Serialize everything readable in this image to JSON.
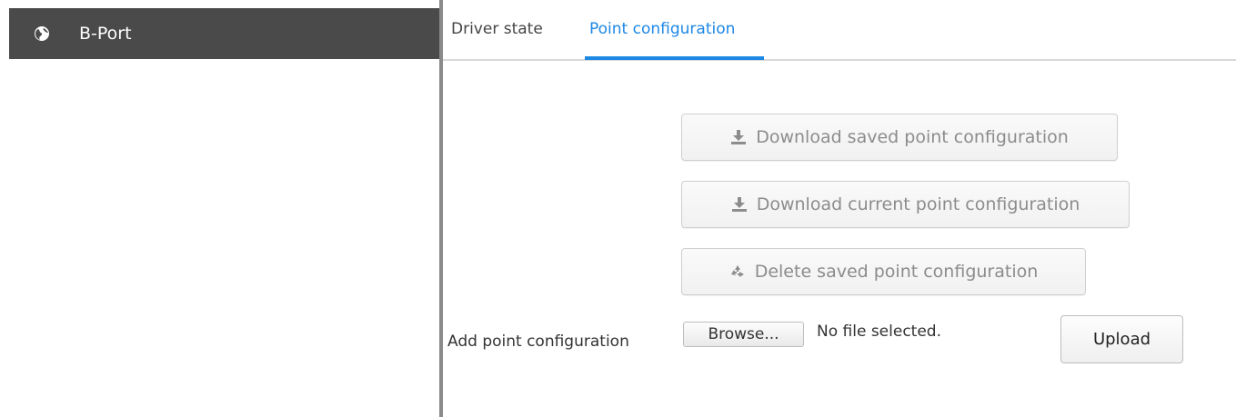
{
  "sidebar": {
    "items": [
      {
        "label": "B-Port",
        "icon": "globe-icon"
      }
    ]
  },
  "tabs": {
    "items": [
      {
        "label": "Driver state",
        "active": false
      },
      {
        "label": "Point configuration",
        "active": true
      }
    ]
  },
  "actions": {
    "download_saved": {
      "label": "Download saved point configuration",
      "icon": "download-icon"
    },
    "download_current": {
      "label": "Download current point configuration",
      "icon": "download-icon"
    },
    "delete_saved": {
      "label": "Delete saved point configuration",
      "icon": "recycle-icon"
    }
  },
  "upload": {
    "label": "Add point configuration",
    "browse_label": "Browse...",
    "file_status": "No file selected.",
    "upload_label": "Upload"
  },
  "colors": {
    "accent": "#1e88e5",
    "sidebar_bg": "#4a4a4a",
    "disabled_text": "#8c8c8c"
  }
}
